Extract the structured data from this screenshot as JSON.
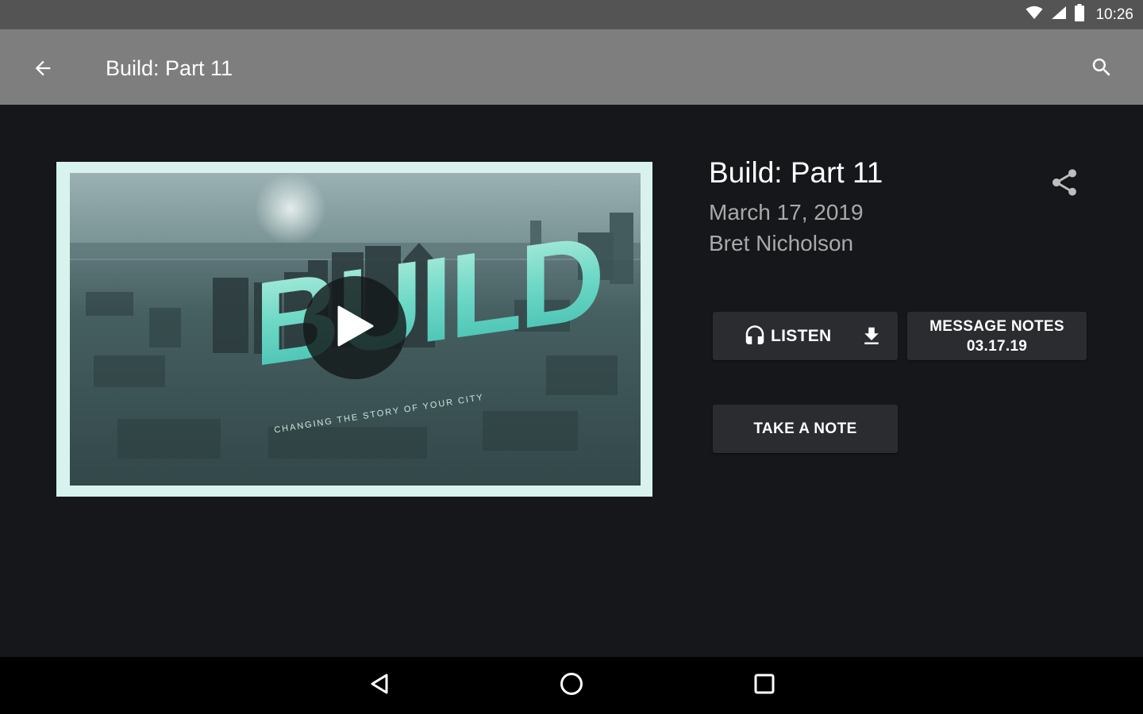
{
  "status_bar": {
    "time": "10:26",
    "icons": [
      "wifi-icon",
      "signal-icon",
      "battery-icon"
    ]
  },
  "app_bar": {
    "title": "Build: Part 11",
    "back_icon": "arrow-back-icon",
    "search_icon": "search-icon"
  },
  "media": {
    "thumbnail": {
      "logo_text": "BUILD",
      "tagline": "CHANGING THE STORY OF YOUR CITY"
    },
    "play_icon": "play-icon"
  },
  "message": {
    "title": "Build: Part 11",
    "date": "March 17, 2019",
    "speaker": "Bret Nicholson",
    "share_icon": "share-icon"
  },
  "actions": {
    "listen_label": "LISTEN",
    "notes_label_line1": "MESSAGE NOTES",
    "notes_label_line2": "03.17.19",
    "take_note_label": "TAKE A NOTE"
  },
  "nav_bar": {
    "items": [
      "back-triangle-icon",
      "home-circle-icon",
      "recents-square-icon"
    ]
  },
  "colors": {
    "status_bar": "#545454",
    "app_bar": "#7e7e7e",
    "background": "#15171a",
    "button": "#2a2c30",
    "accent_teal": "#5fd3c6",
    "frame": "#d8f2ee"
  }
}
